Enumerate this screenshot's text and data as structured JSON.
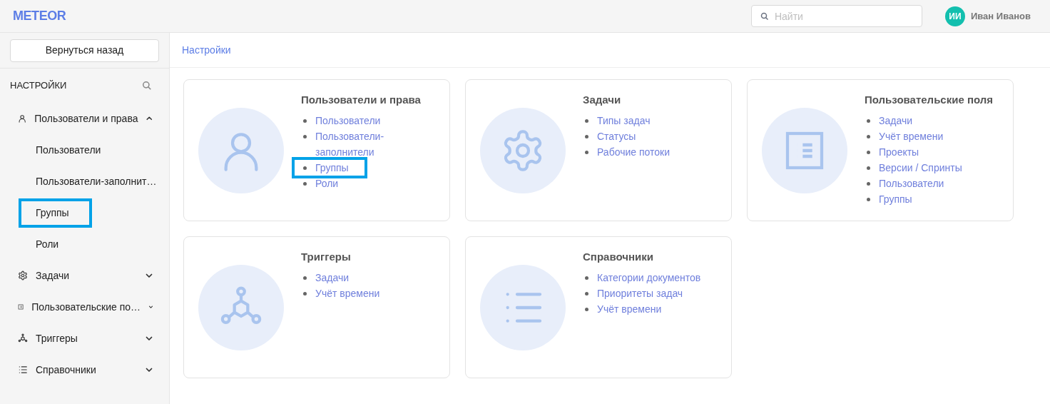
{
  "header": {
    "logo": "METEOR",
    "search": {
      "placeholder": "Найти"
    },
    "user": {
      "initials": "ИИ",
      "name": "Иван Иванов"
    }
  },
  "sidebar": {
    "back_button": "Вернуться назад",
    "title": "НАСТРОЙКИ",
    "items": [
      {
        "label": "Пользователи и права",
        "kind": "user",
        "expanded": true,
        "children": [
          {
            "label": "Пользователи",
            "highlighted": false
          },
          {
            "label": "Пользователи-заполнит…",
            "highlighted": false
          },
          {
            "label": "Группы",
            "highlighted": true
          },
          {
            "label": "Роли",
            "highlighted": false
          }
        ]
      },
      {
        "label": "Задачи",
        "kind": "gear",
        "expanded": false
      },
      {
        "label": "Пользовательские по…",
        "kind": "fields",
        "expanded": false
      },
      {
        "label": "Триггеры",
        "kind": "triggers",
        "expanded": false
      },
      {
        "label": "Справочники",
        "kind": "list",
        "expanded": false
      }
    ]
  },
  "breadcrumb": "Настройки",
  "cards": [
    {
      "title": "Пользователи и права",
      "kind": "user",
      "links": [
        {
          "label": "Пользователи",
          "highlighted": false
        },
        {
          "label": "Пользователи-заполнители",
          "highlighted": false
        },
        {
          "label": "Группы",
          "highlighted": true
        },
        {
          "label": "Роли",
          "highlighted": false
        }
      ]
    },
    {
      "title": "Задачи",
      "kind": "gear",
      "links": [
        {
          "label": "Типы задач",
          "highlighted": false
        },
        {
          "label": "Статусы",
          "highlighted": false
        },
        {
          "label": "Рабочие потоки",
          "highlighted": false
        }
      ]
    },
    {
      "title": "Пользовательские поля",
      "kind": "fields",
      "links": [
        {
          "label": "Задачи",
          "highlighted": false
        },
        {
          "label": "Учёт времени",
          "highlighted": false
        },
        {
          "label": "Проекты",
          "highlighted": false
        },
        {
          "label": "Версии / Спринты",
          "highlighted": false
        },
        {
          "label": "Пользователи",
          "highlighted": false
        },
        {
          "label": "Группы",
          "highlighted": false
        }
      ]
    },
    {
      "title": "Триггеры",
      "kind": "triggers",
      "links": [
        {
          "label": "Задачи",
          "highlighted": false
        },
        {
          "label": "Учёт времени",
          "highlighted": false
        }
      ]
    },
    {
      "title": "Справочники",
      "kind": "list",
      "links": [
        {
          "label": "Категории документов",
          "highlighted": false
        },
        {
          "label": "Приоритеты задач",
          "highlighted": false
        },
        {
          "label": "Учёт времени",
          "highlighted": false
        }
      ]
    }
  ]
}
